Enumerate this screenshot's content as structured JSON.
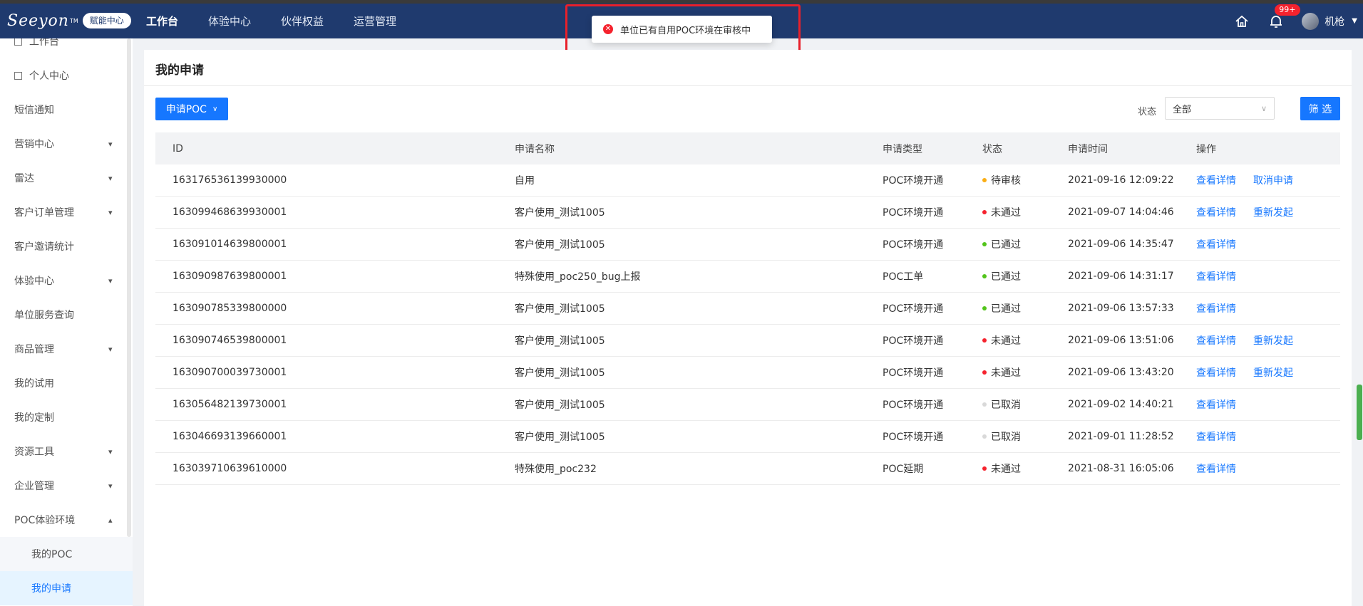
{
  "topbar": {
    "logo_text": "Seeyon",
    "logo_tm": "TM",
    "logo_badge": "赋能中心",
    "nav": [
      "工作台",
      "体验中心",
      "伙伴权益",
      "运营管理"
    ],
    "notification_count": "99+",
    "user_name": "机枪",
    "accent": "#1f3a6e"
  },
  "toast": {
    "message": "单位已有自用POC环境在审核中",
    "icon": "error-circle-icon"
  },
  "sidebar": {
    "items": [
      {
        "label": "工作台",
        "icon": "square-icon",
        "expandable": false
      },
      {
        "label": "个人中心",
        "icon": "square-icon",
        "expandable": false
      },
      {
        "label": "短信通知",
        "expandable": false
      },
      {
        "label": "营销中心",
        "expandable": true
      },
      {
        "label": "雷达",
        "expandable": true
      },
      {
        "label": "客户订单管理",
        "expandable": true
      },
      {
        "label": "客户邀请统计",
        "expandable": false
      },
      {
        "label": "体验中心",
        "expandable": true
      },
      {
        "label": "单位服务查询",
        "expandable": false
      },
      {
        "label": "商品管理",
        "expandable": true
      },
      {
        "label": "我的试用",
        "expandable": false
      },
      {
        "label": "我的定制",
        "expandable": false
      },
      {
        "label": "资源工具",
        "expandable": true
      },
      {
        "label": "企业管理",
        "expandable": true
      },
      {
        "label": "POC体验环境",
        "expandable": true,
        "expanded": true
      },
      {
        "label": "我的POC",
        "sub": true
      },
      {
        "label": "我的申请",
        "sub": true,
        "selected": true
      }
    ]
  },
  "main": {
    "title": "我的申请",
    "apply_button": "申请POC",
    "filter_label": "状态",
    "filter_value": "全部",
    "filter_button": "筛 选",
    "columns": [
      "ID",
      "申请名称",
      "申请类型",
      "状态",
      "申请时间",
      "操作"
    ],
    "status_colors": {
      "待审核": "#faad14",
      "未通过": "#f5222d",
      "已通过": "#52c41a",
      "已取消": "#d9d9d9"
    },
    "rows": [
      {
        "id": "163176536139930000",
        "name": "自用",
        "type": "POC环境开通",
        "status": "待审核",
        "time": "2021-09-16 12:09:22",
        "ops": [
          "查看详情",
          "取消申请"
        ]
      },
      {
        "id": "163099468639930001",
        "name": "客户使用_测试1005",
        "type": "POC环境开通",
        "status": "未通过",
        "time": "2021-09-07 14:04:46",
        "ops": [
          "查看详情",
          "重新发起"
        ]
      },
      {
        "id": "163091014639800001",
        "name": "客户使用_测试1005",
        "type": "POC环境开通",
        "status": "已通过",
        "time": "2021-09-06 14:35:47",
        "ops": [
          "查看详情"
        ]
      },
      {
        "id": "163090987639800001",
        "name": "特殊使用_poc250_bug上报",
        "type": "POC工单",
        "status": "已通过",
        "time": "2021-09-06 14:31:17",
        "ops": [
          "查看详情"
        ]
      },
      {
        "id": "163090785339800000",
        "name": "客户使用_测试1005",
        "type": "POC环境开通",
        "status": "已通过",
        "time": "2021-09-06 13:57:33",
        "ops": [
          "查看详情"
        ]
      },
      {
        "id": "163090746539800001",
        "name": "客户使用_测试1005",
        "type": "POC环境开通",
        "status": "未通过",
        "time": "2021-09-06 13:51:06",
        "ops": [
          "查看详情",
          "重新发起"
        ]
      },
      {
        "id": "163090700039730001",
        "name": "客户使用_测试1005",
        "type": "POC环境开通",
        "status": "未通过",
        "time": "2021-09-06 13:43:20",
        "ops": [
          "查看详情",
          "重新发起"
        ]
      },
      {
        "id": "163056482139730001",
        "name": "客户使用_测试1005",
        "type": "POC环境开通",
        "status": "已取消",
        "time": "2021-09-02 14:40:21",
        "ops": [
          "查看详情"
        ]
      },
      {
        "id": "163046693139660001",
        "name": "客户使用_测试1005",
        "type": "POC环境开通",
        "status": "已取消",
        "time": "2021-09-01 11:28:52",
        "ops": [
          "查看详情"
        ]
      },
      {
        "id": "163039710639610000",
        "name": "特殊使用_poc232",
        "type": "POC延期",
        "status": "未通过",
        "time": "2021-08-31 16:05:06",
        "ops": [
          "查看详情"
        ]
      }
    ]
  }
}
